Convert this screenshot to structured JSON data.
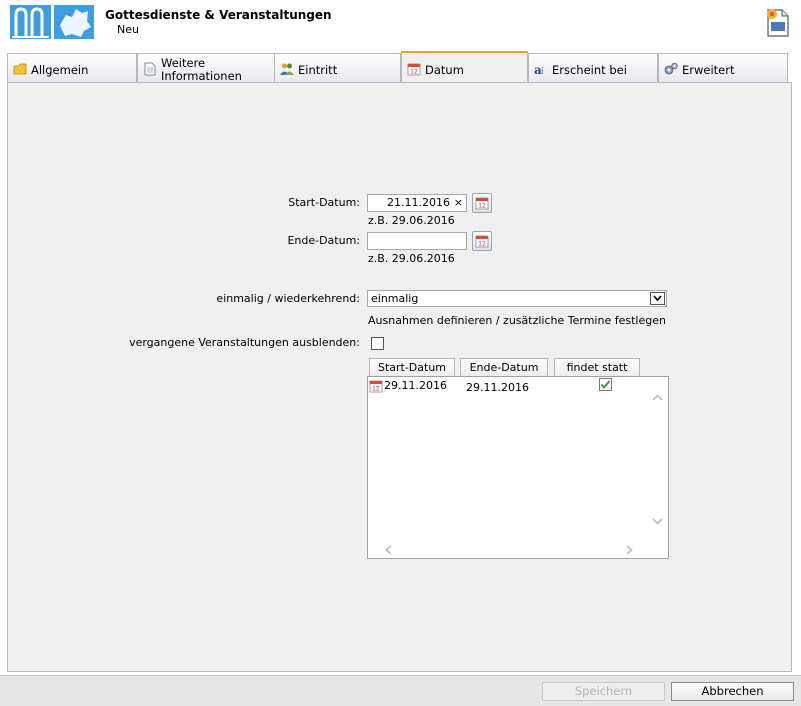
{
  "header": {
    "title": "Gottesdienste & Veranstaltungen",
    "subtitle": "Neu"
  },
  "tabs": [
    {
      "label": "Allgemein",
      "icon": "folder-icon"
    },
    {
      "label": "Weitere Informationen",
      "icon": "document-icon"
    },
    {
      "label": "Eintritt",
      "icon": "people-icon"
    },
    {
      "label": "Datum",
      "icon": "calendar-icon",
      "active": true
    },
    {
      "label": "Erscheint bei",
      "icon": "font-icon"
    },
    {
      "label": "Erweitert",
      "icon": "settings-icon"
    }
  ],
  "form": {
    "start_label": "Start-Datum:",
    "start_value": "21.11.2016",
    "start_hint": "z.B. 29.06.2016",
    "end_label": "Ende-Datum:",
    "end_value": "",
    "end_hint": "z.B. 29.06.2016",
    "recurrence_label": "einmalig / wiederkehrend:",
    "recurrence_value": "einmalig",
    "exceptions_text": "Ausnahmen definieren / zusätzliche Termine festlegen",
    "hide_past_label": "vergangene Veranstaltungen ausblenden:",
    "clear_symbol": "×"
  },
  "dates_table": {
    "columns": [
      "Start-Datum",
      "Ende-Datum",
      "findet statt"
    ],
    "rows": [
      {
        "start": "29.11.2016",
        "end": "29.11.2016",
        "takes_place": true
      }
    ]
  },
  "footer": {
    "save_label": "Speichern",
    "cancel_label": "Abbrechen"
  }
}
